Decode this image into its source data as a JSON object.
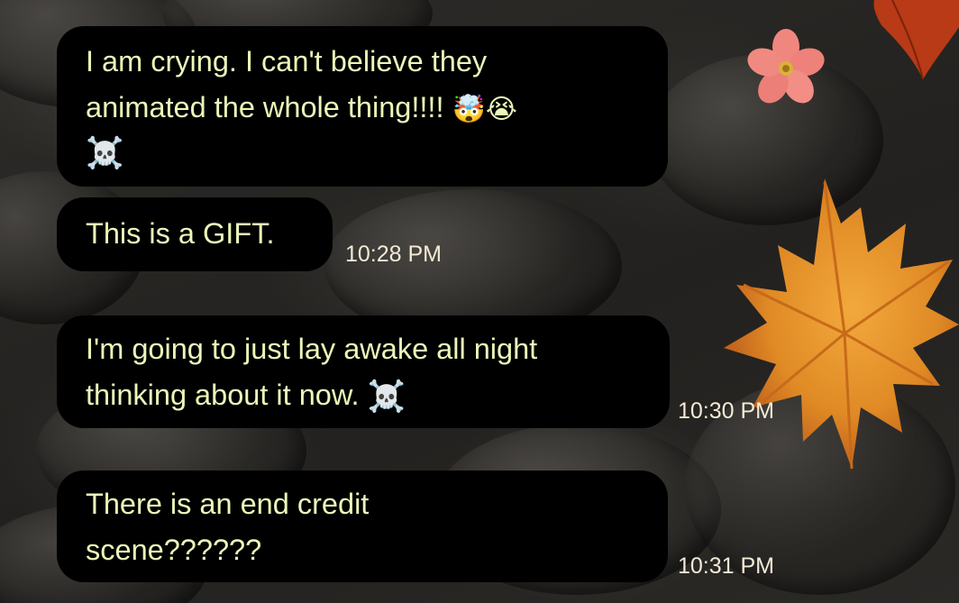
{
  "messages": [
    {
      "text": "I am crying. I can't believe they\nanimated the whole thing!!!! ",
      "emojis": "🤯😭",
      "trailing_emoji": "☠️",
      "time": ""
    },
    {
      "text": "This is a GIFT.",
      "time": "10:28 PM"
    },
    {
      "text": "I'm going to just lay awake all night\nthinking about it now. ",
      "emojis": "☠️",
      "time": "10:30 PM"
    },
    {
      "text": "There is an end credit\nscene??????",
      "time": "10:31 PM"
    }
  ],
  "wallpaper": {
    "theme": "dark pebbles with autumn leaves",
    "colors": {
      "bubble": "#000000",
      "text": "#eaf7b9",
      "timestamp": "#f3ead6",
      "maple_leaf": "#e8962a",
      "flower": "#f08a8a",
      "red_leaf": "#c2421a"
    }
  }
}
